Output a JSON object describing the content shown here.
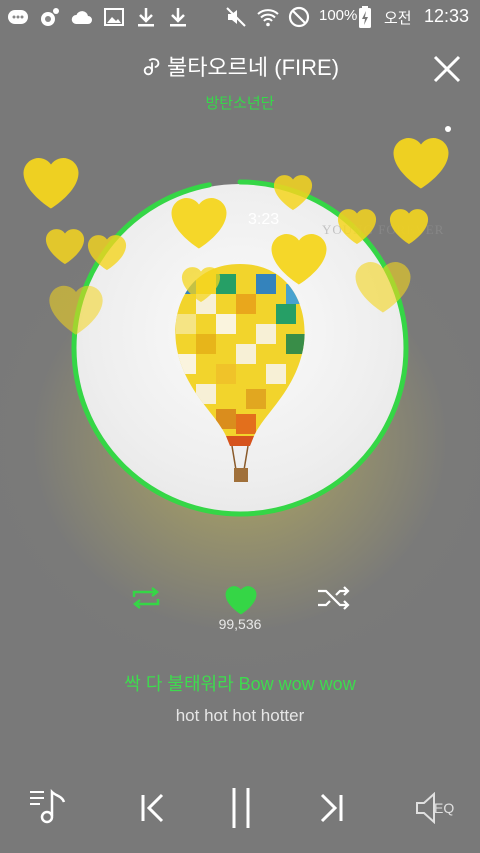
{
  "status_bar": {
    "battery_percent": "100%",
    "ampm": "오전",
    "time": "12:33",
    "icons": [
      "chat-icon",
      "music-app-icon",
      "cloud-icon",
      "gallery-icon",
      "download-icon",
      "download-icon",
      "mute-icon",
      "wifi-icon",
      "no-disturb-icon",
      "battery-charging-icon"
    ]
  },
  "header": {
    "title": "불타오르네 (FIRE)",
    "artist": "방탄소년단"
  },
  "player": {
    "elapsed_time": "3:23",
    "progress": 0.97,
    "watermark": "YOUNG FOREVER",
    "like_count": "99,536"
  },
  "lyrics": {
    "current": "싹 다 불태워라 Bow wow wow",
    "next": "hot hot hot hotter"
  },
  "bottom_bar": {
    "eq_label": "EQ"
  },
  "colors": {
    "accent": "#35d646",
    "heart": "#f4d51e",
    "background": "#7a7a7a"
  }
}
